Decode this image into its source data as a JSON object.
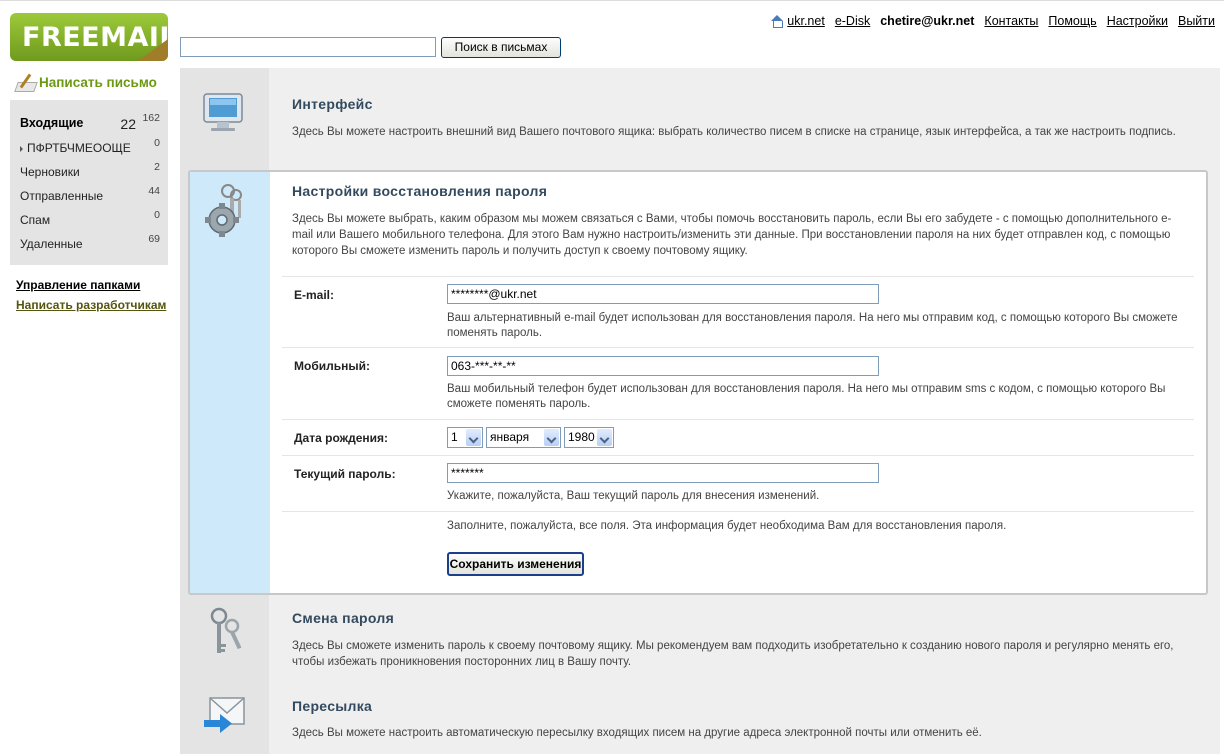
{
  "logo": {
    "text": "FREEMAIL"
  },
  "search": {
    "value": "",
    "button": "Поиск в письмах"
  },
  "topnav": {
    "home": "ukr.net",
    "disk": "e-Disk",
    "email": "chetire@ukr.net",
    "contacts": "Контакты",
    "help": "Помощь",
    "settings": "Настройки",
    "logout": "Выйти"
  },
  "sidebar": {
    "compose": "Написать письмо",
    "folders": [
      {
        "name": "Входящие",
        "unread": "22",
        "count": "162"
      },
      {
        "name": "ПФРТБЧМЕООЩЕ",
        "count": "0"
      },
      {
        "name": "Черновики",
        "count": "2"
      },
      {
        "name": "Отправленные",
        "count": "44"
      },
      {
        "name": "Спам",
        "count": "0"
      },
      {
        "name": "Удаленные",
        "count": "69"
      }
    ],
    "manage_folders": "Управление папками",
    "write_devs": "Написать разработчикам"
  },
  "sections": {
    "interface": {
      "title": "Интерфейс",
      "desc": "Здесь Вы можете настроить внешний вид Вашего почтового ящика: выбрать количество писем в списке на странице, язык интерфейса, а так же настроить подпись."
    },
    "recovery": {
      "title": "Настройки восстановления пароля",
      "desc": "Здесь Вы можете выбрать, каким образом мы можем связаться с Вами, чтобы помочь восстановить пароль, если Вы его забудете - с помощью дополнительного e-mail или Вашего мобильного телефона. Для этого Вам нужно настроить/изменить эти данные. При восстановлении пароля на них будет отправлен код, с помощью которого Вы сможете изменить пароль и получить доступ к своему почтовому ящику."
    },
    "change_password": {
      "title": "Смена пароля",
      "desc": "Здесь Вы сможете изменить пароль к своему почтовому ящику. Мы рекомендуем вам подходить изобретательно к созданию нового пароля и регулярно менять его, чтобы избежать проникновения посторонних лиц в Вашу почту."
    },
    "forwarding": {
      "title": "Пересылка",
      "desc": "Здесь Вы можете настроить автоматическую пересылку входящих писем на другие адреса электронной почты или отменить её."
    }
  },
  "form": {
    "email_label": "E-mail:",
    "email_value": "********@ukr.net",
    "email_hint": "Ваш альтернативный e-mail будет использован для восстановления пароля. На него мы отправим код, с помощью которого Вы сможете поменять пароль.",
    "mobile_label": "Мобильный:",
    "mobile_value": "063-***-**-**",
    "mobile_hint": "Ваш мобильный телефон будет использован для восстановления пароля. На него мы отправим sms с кодом, с помощью которого Вы сможете поменять пароль.",
    "birth_label": "Дата рождения:",
    "birth_day": "1",
    "birth_month": "января",
    "birth_year": "1980",
    "password_label": "Текущий пароль:",
    "password_value": "*******",
    "password_hint": "Укажите, пожалуйста, Ваш текущий пароль для внесения изменений.",
    "fill_note": "Заполните, пожалуйста, все поля. Эта информация будет необходима Вам для восстановления пароля.",
    "save_button": "Сохранить изменения"
  },
  "colors": {
    "accent_green": "#6b9a12",
    "active_blue": "#cde9fa",
    "title": "#334a5e"
  }
}
